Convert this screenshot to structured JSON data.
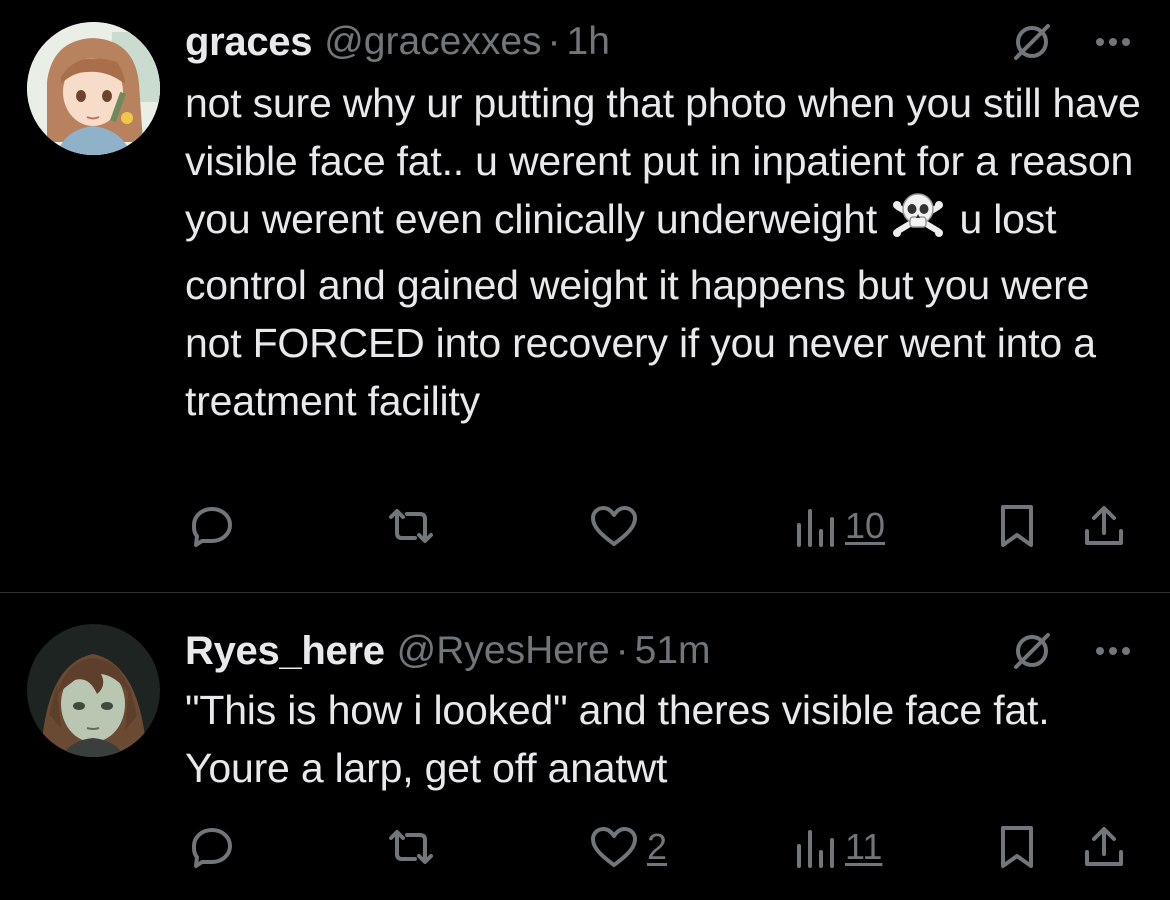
{
  "colors": {
    "background": "#000000",
    "text_primary": "#e7e9ea",
    "text_secondary": "#71767b",
    "divider": "#2f3336"
  },
  "tweets": [
    {
      "display_name": "graces",
      "handle": "@gracexxes",
      "separator": "·",
      "time": "1h",
      "text_before_emoji": "not sure why ur putting that photo when you still have visible face fat.. u werent put in inpatient for a reason you werent even clinically underweight",
      "emoji": "skull-and-crossbones",
      "text_after_emoji": "u lost control and gained weight it happens but you were not FORCED into recovery if you never went into a treatment facility",
      "replies": "",
      "retweets": "",
      "likes": "",
      "views": "10",
      "avatar_icon": "anime-girl-avatar"
    },
    {
      "display_name": "Ryes_here",
      "handle": "@RyesHere",
      "separator": "·",
      "time": "51m",
      "text": "\"This is how i looked\" and theres visible face fat. Youre a larp, get off anatwt",
      "replies": "",
      "retweets": "",
      "likes": "2",
      "views": "11",
      "avatar_icon": "anime-character-avatar"
    }
  ]
}
